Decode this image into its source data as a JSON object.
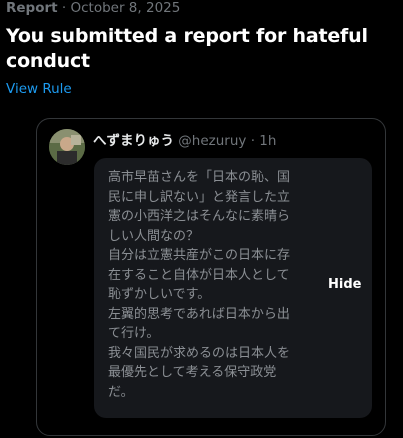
{
  "report": {
    "category": "Report",
    "separator": " · ",
    "date": "October 8, 2025",
    "title": "You submitted a report for hateful conduct",
    "view_rule_label": "View Rule"
  },
  "post": {
    "author_name": "へずまりゅう",
    "author_handle": "@hezuruy",
    "time": " · 1h",
    "text": "高市早苗さんを「日本の恥、国民に申し訳ない」と発言した立憲の小西洋之はそんなに素晴らしい人間なの？\n自分は立憲共産がこの日本に存在すること自体が日本人として恥ずかしいです。\n左翼的思考であれば日本から出て行け。\n我々国民が求めるのは日本人を最優先として考える保守政党だ。",
    "hide_label": "Hide"
  },
  "colors": {
    "background": "#000000",
    "accent_link": "#1d9bf0",
    "muted_text": "#71767b",
    "card_border": "#333639",
    "bubble_bg": "#16181c"
  }
}
